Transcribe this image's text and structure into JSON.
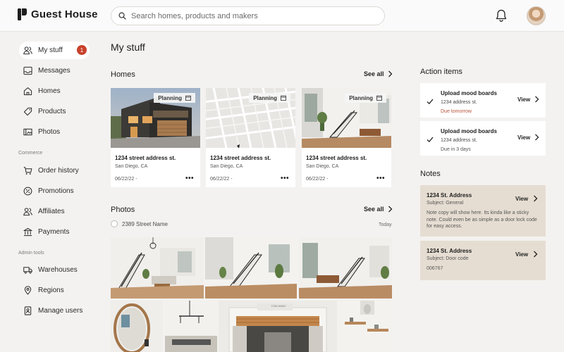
{
  "app": {
    "title": "Guest House"
  },
  "search": {
    "placeholder": "Search homes, products and makers"
  },
  "sidebar": {
    "items": [
      {
        "label": "My stuff",
        "badge": "1"
      },
      {
        "label": "Messages"
      },
      {
        "label": "Homes"
      },
      {
        "label": "Products"
      },
      {
        "label": "Photos"
      }
    ],
    "commerce_label": "Commerce",
    "commerce": [
      {
        "label": "Order history"
      },
      {
        "label": "Promotions"
      },
      {
        "label": "Affiliates"
      },
      {
        "label": "Payments"
      }
    ],
    "admin_label": "Admin tools",
    "admin": [
      {
        "label": "Warehouses"
      },
      {
        "label": "Regions"
      },
      {
        "label": "Manage users"
      }
    ]
  },
  "main": {
    "title": "My stuff",
    "homes": {
      "title": "Homes",
      "see_all": "See all",
      "cards": [
        {
          "status": "Planning",
          "address": "1234 street address st.",
          "city": "San Diego, CA",
          "date": "06/22/22 -",
          "menu": "•••",
          "image": "house-exterior"
        },
        {
          "status": "Planning",
          "address": "1234 street address st.",
          "city": "San Diego, CA",
          "date": "06/22/22 -",
          "menu": "•••",
          "image": "street-map"
        },
        {
          "status": "Planning",
          "address": "1234 street address st.",
          "city": "San Diego, CA",
          "date": "06/22/22 -",
          "menu": "•••",
          "image": "living-room"
        }
      ]
    },
    "photos": {
      "title": "Photos",
      "see_all": "See all",
      "group_label": "2389 Street Name",
      "group_date": "Today",
      "sign_text": "TOW AWAY"
    }
  },
  "action_items": {
    "title": "Action items",
    "items": [
      {
        "title": "Upload mood boards",
        "address": "1234 address st.",
        "due": "Due tomorrow",
        "view": "View"
      },
      {
        "title": "Upload mood boards",
        "address": "1234 address st.",
        "due": "Due in 3 days",
        "view": "View"
      }
    ]
  },
  "notes": {
    "title": "Notes",
    "items": [
      {
        "title": "1234 St. Address",
        "subject": "Subject: General",
        "body": "Note copy will show here. Its kinda like a sticky note. Could even be as simple as a door lock code for easy access.",
        "view": "View"
      },
      {
        "title": "1234 St. Address",
        "subject": "Subject: Door code",
        "body": "006767",
        "view": "View"
      }
    ]
  },
  "colors": {
    "accent": "#c9412b",
    "note_bg": "#e6ddd2",
    "page_bg": "#f3f2f0"
  }
}
